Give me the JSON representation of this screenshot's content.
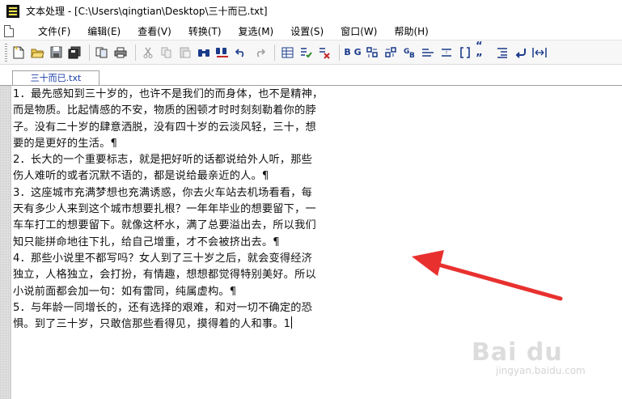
{
  "window": {
    "title": "文本处理 - [C:\\Users\\qingtian\\Desktop\\三十而已.txt]"
  },
  "menu": [
    {
      "label": "文件(F)"
    },
    {
      "label": "编辑(E)"
    },
    {
      "label": "查看(V)"
    },
    {
      "label": "转换(T)"
    },
    {
      "label": "复选(M)"
    },
    {
      "label": "设置(S)"
    },
    {
      "label": "窗口(W)"
    },
    {
      "label": "帮助(H)"
    }
  ],
  "toolbar": {
    "glyphs": {
      "bg": "B G",
      "quotes": "“ ”"
    }
  },
  "tab": {
    "label": "三十而已.txt"
  },
  "editor": {
    "lines": [
      "1．最先感知到三十岁的，也许不是我们的而身体，也不是精神，",
      "而是物质。比起情感的不安，物质的困顿才时时刻刻勒着你的脖",
      "子。没有二十岁的肆意洒脱，没有四十岁的云淡风轻，三十，想",
      "要的是更好的生活。¶",
      "2．长大的一个重要标志，就是把好听的话都说给外人听，那些",
      "伤人难听的或者沉默不语的，都是说给最亲近的人。¶",
      "3．这座城市充满梦想也充满诱惑，你去火车站去机场看看，每",
      "天有多少人来到这个城市想要扎根？一年年毕业的想要留下，一",
      "车车打工的想要留下。就像这杯水，满了总要溢出去，所以我们",
      "知只能拼命地往下扎，给自己增重，才不会被挤出去。¶",
      "4．那些小说里不都写吗？女人到了三十岁之后，就会变得经济",
      "独立，人格独立，会打扮，有情趣，想想都觉得特别美好。所以",
      "小说前面都会加一句：如有雷同，纯属虚构。¶",
      "5．与年龄一同增长的，还有选择的艰难，和对一切不确定的恐",
      "惧。到了三十岁，只敢信那些看得见，摸得着的人和事。1"
    ]
  },
  "watermark": {
    "logo": "Bai du",
    "sub": "jingyan.baidu.com"
  },
  "colors": {
    "arrow": "#e8312f",
    "tab_text": "#1a3ea8"
  }
}
